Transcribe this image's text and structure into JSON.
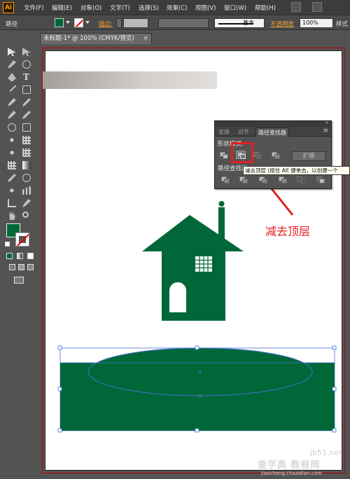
{
  "app": {
    "logo": "Ai"
  },
  "menu": {
    "items": [
      "文件(F)",
      "编辑(E)",
      "对象(O)",
      "文字(T)",
      "选择(S)",
      "效果(C)",
      "视图(V)",
      "窗口(W)",
      "帮助(H)"
    ]
  },
  "control": {
    "mode_label": "路径",
    "stroke_label": "描边:",
    "stroke_style": "基本",
    "opacity_label": "不透明度",
    "opacity_value": "100%",
    "style_label": "样式"
  },
  "document": {
    "tab_title": "未标题-1* @ 100% (CMYK/预览)",
    "close_glyph": "×"
  },
  "pathfinder": {
    "tabs": [
      "变换",
      "对齐",
      "路径查找器"
    ],
    "active_tab": "路径查找器",
    "shape_modes_label": "形状模式:",
    "pathfinders_label": "路径查找器:",
    "expand_button": "扩展",
    "menu_glyph": "≡"
  },
  "tooltip": {
    "text": "减去顶层 (按住 Alt 键单击，以创建一个"
  },
  "annotation": {
    "text": "减去顶层"
  },
  "colors": {
    "fill": "#006838",
    "accent": "#e52020",
    "selection": "#4a6fd8"
  },
  "watermark": {
    "site": "jb51.net",
    "brand": "查字典 教程网",
    "url": "jiaocheng.chazidian.com"
  }
}
